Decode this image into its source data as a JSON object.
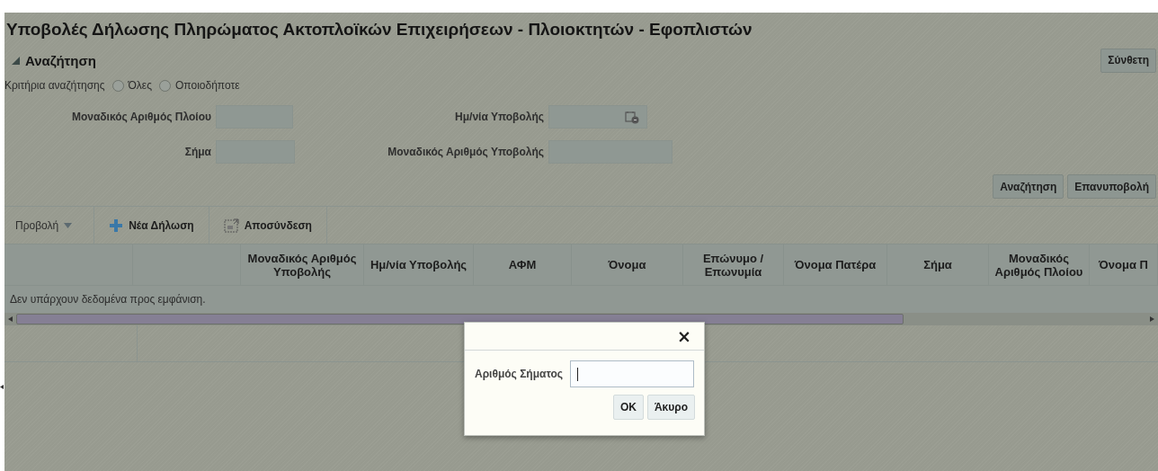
{
  "page_title": "Υποβολές Δήλωσης Πληρώματος Ακτοπλοϊκών Επιχειρήσεων - Πλοιοκτητών - Εφοπλιστών",
  "search": {
    "title": "Αναζήτηση",
    "expanded": true,
    "advanced_button": "Σύνθετη",
    "criteria_label": "Κριτήρια αναζήτησης",
    "criteria_options": [
      {
        "label": "Όλες",
        "selected": false
      },
      {
        "label": "Οποιοδήποτε",
        "selected": false
      }
    ],
    "fields": [
      {
        "label": "Μοναδικός Αριθμός Πλοίου",
        "kind": "text"
      },
      {
        "label": "Ημ/νία Υποβολής",
        "kind": "date"
      },
      {
        "label": "Σήμα",
        "kind": "text"
      },
      {
        "label": "Μοναδικός Αριθμός Υποβολής",
        "kind": "text"
      }
    ],
    "buttons": [
      "Αναζήτηση",
      "Επανυποβολή"
    ]
  },
  "toolbar": {
    "view_menu": "Προβολή",
    "items": [
      {
        "label": "Νέα Δήλωση",
        "kind": "add"
      },
      {
        "label": "Αποσύνδεση",
        "kind": "detach"
      }
    ]
  },
  "table": {
    "columns": [
      "",
      "",
      "Μοναδικός Αριθμός Υποβολής",
      "Ημ/νία Υποβολής",
      "ΑΦΜ",
      "Όνομα",
      "Επώνυμο / Επωνυμία",
      "Όνομα Πατέρα",
      "Σήμα",
      "Μοναδικός Αριθμός Πλοίου",
      "Όνομα Π"
    ],
    "empty_message": "Δεν υπάρχουν δεδομένα προς εμφάνιση."
  },
  "dialog": {
    "close": "×",
    "field_label": "Αριθμός Σήματος",
    "buttons": [
      "OK",
      "Άκυρο"
    ]
  }
}
